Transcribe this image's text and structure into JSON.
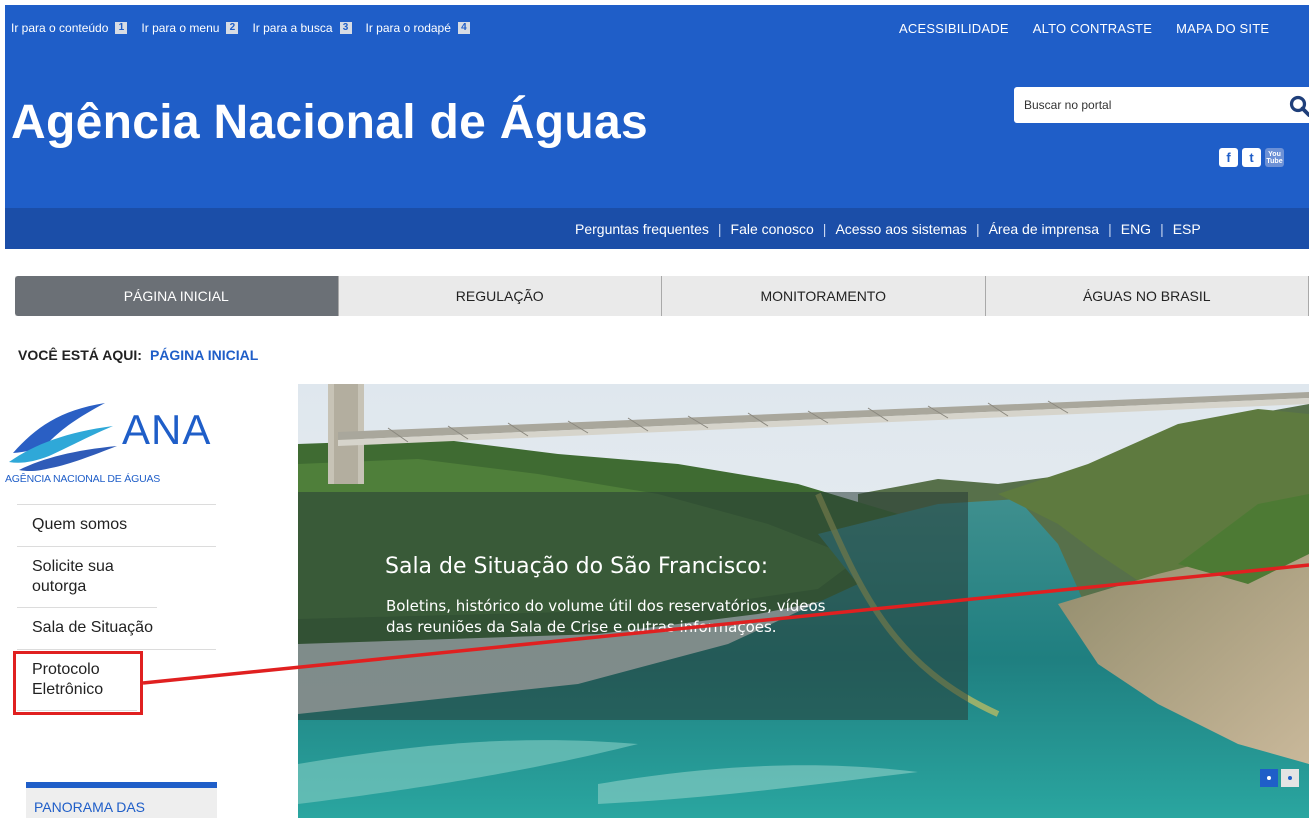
{
  "skip_links": [
    {
      "label": "Ir para o conteúdo",
      "key": "1"
    },
    {
      "label": "Ir para o menu",
      "key": "2"
    },
    {
      "label": "Ir para a busca",
      "key": "3"
    },
    {
      "label": "Ir para o rodapé",
      "key": "4"
    }
  ],
  "top_links": [
    "ACESSIBILIDADE",
    "ALTO CONTRASTE",
    "MAPA DO SITE"
  ],
  "site_title": "Agência Nacional de Águas",
  "search": {
    "placeholder": "Buscar no portal"
  },
  "social": {
    "facebook": "f",
    "twitter": "t",
    "youtube_top": "You",
    "youtube_bottom": "Tube"
  },
  "util_links": [
    "Perguntas frequentes",
    "Fale conosco",
    "Acesso aos sistemas",
    "Área de imprensa",
    "ENG",
    "ESP"
  ],
  "nav_tabs": [
    "PÁGINA INICIAL",
    "REGULAÇÃO",
    "MONITORAMENTO",
    "ÁGUAS NO BRASIL"
  ],
  "breadcrumb": {
    "label": "VOCÊ ESTÁ AQUI:",
    "current": "PÁGINA INICIAL"
  },
  "logo": {
    "name": "ANA",
    "subtitle": "AGÊNCIA NACIONAL DE ÁGUAS"
  },
  "sidebar": {
    "items": [
      {
        "label": "Quem somos"
      },
      {
        "label": "Solicite sua outorga"
      },
      {
        "label": "Sala de Situação"
      },
      {
        "label": "Protocolo Eletrônico"
      }
    ],
    "panorama": "PANORAMA DAS"
  },
  "hero": {
    "title": "Sala de Situação do São Francisco:",
    "description": "Boletins, histórico do volume útil dos reservatórios, vídeos das reuniões da Sala de Crise e outras informações."
  },
  "colors": {
    "primary": "#1f5ec8",
    "util_bar": "#1b4ea8",
    "highlight": "#e02020",
    "active_tab": "#6b7076"
  }
}
